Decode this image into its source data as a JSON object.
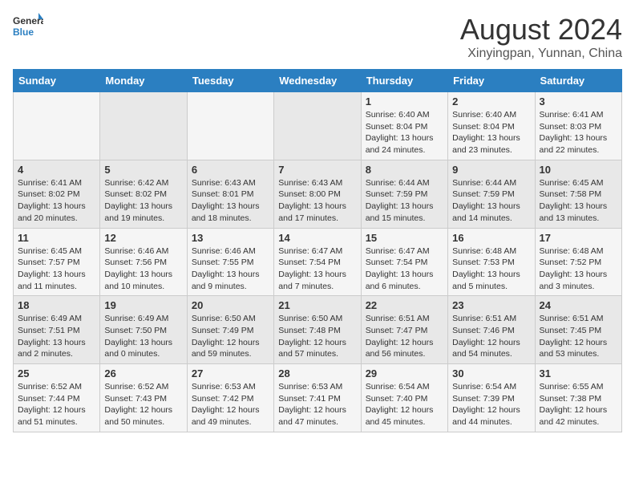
{
  "logo": {
    "line1": "General",
    "line2": "Blue"
  },
  "title": "August 2024",
  "subtitle": "Xinyingpan, Yunnan, China",
  "weekdays": [
    "Sunday",
    "Monday",
    "Tuesday",
    "Wednesday",
    "Thursday",
    "Friday",
    "Saturday"
  ],
  "weeks": [
    [
      {
        "day": "",
        "content": ""
      },
      {
        "day": "",
        "content": ""
      },
      {
        "day": "",
        "content": ""
      },
      {
        "day": "",
        "content": ""
      },
      {
        "day": "1",
        "content": "Sunrise: 6:40 AM\nSunset: 8:04 PM\nDaylight: 13 hours and 24 minutes."
      },
      {
        "day": "2",
        "content": "Sunrise: 6:40 AM\nSunset: 8:04 PM\nDaylight: 13 hours and 23 minutes."
      },
      {
        "day": "3",
        "content": "Sunrise: 6:41 AM\nSunset: 8:03 PM\nDaylight: 13 hours and 22 minutes."
      }
    ],
    [
      {
        "day": "4",
        "content": "Sunrise: 6:41 AM\nSunset: 8:02 PM\nDaylight: 13 hours and 20 minutes."
      },
      {
        "day": "5",
        "content": "Sunrise: 6:42 AM\nSunset: 8:02 PM\nDaylight: 13 hours and 19 minutes."
      },
      {
        "day": "6",
        "content": "Sunrise: 6:43 AM\nSunset: 8:01 PM\nDaylight: 13 hours and 18 minutes."
      },
      {
        "day": "7",
        "content": "Sunrise: 6:43 AM\nSunset: 8:00 PM\nDaylight: 13 hours and 17 minutes."
      },
      {
        "day": "8",
        "content": "Sunrise: 6:44 AM\nSunset: 7:59 PM\nDaylight: 13 hours and 15 minutes."
      },
      {
        "day": "9",
        "content": "Sunrise: 6:44 AM\nSunset: 7:59 PM\nDaylight: 13 hours and 14 minutes."
      },
      {
        "day": "10",
        "content": "Sunrise: 6:45 AM\nSunset: 7:58 PM\nDaylight: 13 hours and 13 minutes."
      }
    ],
    [
      {
        "day": "11",
        "content": "Sunrise: 6:45 AM\nSunset: 7:57 PM\nDaylight: 13 hours and 11 minutes."
      },
      {
        "day": "12",
        "content": "Sunrise: 6:46 AM\nSunset: 7:56 PM\nDaylight: 13 hours and 10 minutes."
      },
      {
        "day": "13",
        "content": "Sunrise: 6:46 AM\nSunset: 7:55 PM\nDaylight: 13 hours and 9 minutes."
      },
      {
        "day": "14",
        "content": "Sunrise: 6:47 AM\nSunset: 7:54 PM\nDaylight: 13 hours and 7 minutes."
      },
      {
        "day": "15",
        "content": "Sunrise: 6:47 AM\nSunset: 7:54 PM\nDaylight: 13 hours and 6 minutes."
      },
      {
        "day": "16",
        "content": "Sunrise: 6:48 AM\nSunset: 7:53 PM\nDaylight: 13 hours and 5 minutes."
      },
      {
        "day": "17",
        "content": "Sunrise: 6:48 AM\nSunset: 7:52 PM\nDaylight: 13 hours and 3 minutes."
      }
    ],
    [
      {
        "day": "18",
        "content": "Sunrise: 6:49 AM\nSunset: 7:51 PM\nDaylight: 13 hours and 2 minutes."
      },
      {
        "day": "19",
        "content": "Sunrise: 6:49 AM\nSunset: 7:50 PM\nDaylight: 13 hours and 0 minutes."
      },
      {
        "day": "20",
        "content": "Sunrise: 6:50 AM\nSunset: 7:49 PM\nDaylight: 12 hours and 59 minutes."
      },
      {
        "day": "21",
        "content": "Sunrise: 6:50 AM\nSunset: 7:48 PM\nDaylight: 12 hours and 57 minutes."
      },
      {
        "day": "22",
        "content": "Sunrise: 6:51 AM\nSunset: 7:47 PM\nDaylight: 12 hours and 56 minutes."
      },
      {
        "day": "23",
        "content": "Sunrise: 6:51 AM\nSunset: 7:46 PM\nDaylight: 12 hours and 54 minutes."
      },
      {
        "day": "24",
        "content": "Sunrise: 6:51 AM\nSunset: 7:45 PM\nDaylight: 12 hours and 53 minutes."
      }
    ],
    [
      {
        "day": "25",
        "content": "Sunrise: 6:52 AM\nSunset: 7:44 PM\nDaylight: 12 hours and 51 minutes."
      },
      {
        "day": "26",
        "content": "Sunrise: 6:52 AM\nSunset: 7:43 PM\nDaylight: 12 hours and 50 minutes."
      },
      {
        "day": "27",
        "content": "Sunrise: 6:53 AM\nSunset: 7:42 PM\nDaylight: 12 hours and 49 minutes."
      },
      {
        "day": "28",
        "content": "Sunrise: 6:53 AM\nSunset: 7:41 PM\nDaylight: 12 hours and 47 minutes."
      },
      {
        "day": "29",
        "content": "Sunrise: 6:54 AM\nSunset: 7:40 PM\nDaylight: 12 hours and 45 minutes."
      },
      {
        "day": "30",
        "content": "Sunrise: 6:54 AM\nSunset: 7:39 PM\nDaylight: 12 hours and 44 minutes."
      },
      {
        "day": "31",
        "content": "Sunrise: 6:55 AM\nSunset: 7:38 PM\nDaylight: 12 hours and 42 minutes."
      }
    ]
  ]
}
